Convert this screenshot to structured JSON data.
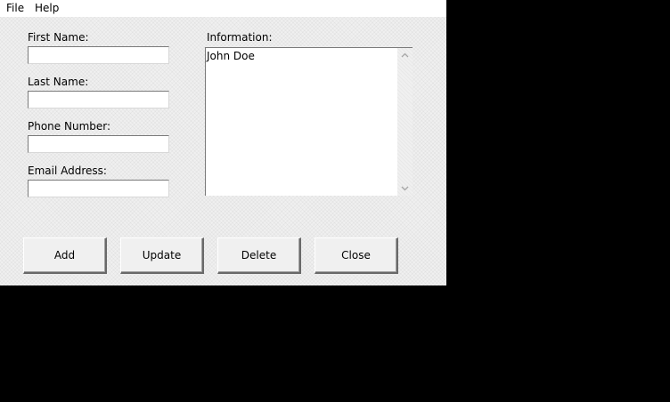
{
  "menu": {
    "items": [
      {
        "label": "File"
      },
      {
        "label": "Help"
      }
    ]
  },
  "form": {
    "first_name": {
      "label": "First Name:",
      "value": ""
    },
    "last_name": {
      "label": "Last Name:",
      "value": ""
    },
    "phone": {
      "label": "Phone Number:",
      "value": ""
    },
    "email": {
      "label": "Email Address:",
      "value": ""
    }
  },
  "info": {
    "label": "Information:",
    "items": [
      "John Doe"
    ]
  },
  "buttons": {
    "add": "Add",
    "update": "Update",
    "delete": "Delete",
    "close": "Close"
  },
  "icons": {
    "scroll_up": "chevron-up-icon",
    "scroll_down": "chevron-down-icon"
  }
}
